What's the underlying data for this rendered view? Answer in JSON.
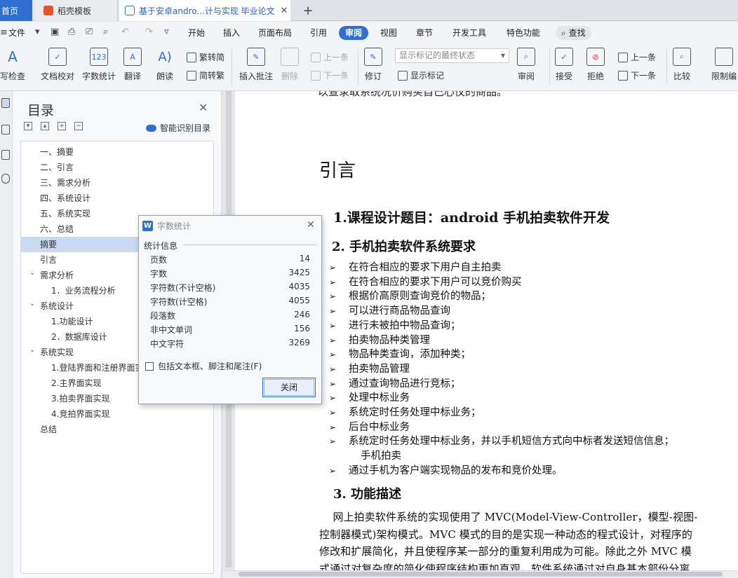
{
  "tabs": {
    "home": "首页",
    "template": "稻壳模板",
    "document": "基于安卓andro...计与实现 毕业论文",
    "add": "+"
  },
  "menu": {
    "file": "文件",
    "items": [
      "开始",
      "插入",
      "页面布局",
      "引用",
      "审阅",
      "视图",
      "章节",
      "开发工具",
      "特色功能"
    ],
    "active": "审阅",
    "search": "查找"
  },
  "ribbon": {
    "spell": "写检查",
    "proof": "文档校对",
    "wordcount": "字数统计",
    "translate": "翻译",
    "read": "朗读",
    "trad": "繁转简",
    "simp": "简转繁",
    "insert_comment": "插入批注",
    "delete": "删除",
    "prev": "上一条",
    "next": "下一条",
    "revise": "修订",
    "markup_state": "显示标记的最终状态",
    "show_markup": "显示标记",
    "review": "审阅",
    "accept": "接受",
    "reject": "拒绝",
    "prev2": "上一条",
    "next2": "下一条",
    "compare": "比较",
    "restrict": "限制编"
  },
  "toc": {
    "title": "目录",
    "smart": "智能识别目录",
    "items": [
      {
        "text": "一、摘要",
        "indent": 1
      },
      {
        "text": "二、引言",
        "indent": 1
      },
      {
        "text": "三、需求分析",
        "indent": 1
      },
      {
        "text": "四、系统设计",
        "indent": 1
      },
      {
        "text": "五、系统实现",
        "indent": 1
      },
      {
        "text": "六、总结",
        "indent": 1
      },
      {
        "text": "摘要",
        "indent": 1,
        "selected": true
      },
      {
        "text": "引言",
        "indent": 1
      },
      {
        "text": "需求分析",
        "indent": 1,
        "expand": true
      },
      {
        "text": "1．业务流程分析",
        "indent": 2
      },
      {
        "text": "系统设计",
        "indent": 1,
        "expand": true
      },
      {
        "text": "1.功能设计",
        "indent": 2
      },
      {
        "text": "2．数据库设计",
        "indent": 2
      },
      {
        "text": "系统实现",
        "indent": 1,
        "expand": true
      },
      {
        "text": "1.登陆界面和注册界面实",
        "indent": 2
      },
      {
        "text": "2.主界面实现",
        "indent": 2
      },
      {
        "text": "3.拍卖界面实现",
        "indent": 2
      },
      {
        "text": "4.竞拍界面实现",
        "indent": 2
      },
      {
        "text": "总结",
        "indent": 1
      }
    ]
  },
  "dialog": {
    "title": "字数统计",
    "section": "统计信息",
    "stats": [
      {
        "label": "页数",
        "value": "14"
      },
      {
        "label": "字数",
        "value": "3425"
      },
      {
        "label": "字符数(不计空格)",
        "value": "4035"
      },
      {
        "label": "字符数(计空格)",
        "value": "4055"
      },
      {
        "label": "段落数",
        "value": "246"
      },
      {
        "label": "非中文单词",
        "value": "156"
      },
      {
        "label": "中文字符",
        "value": "3269"
      }
    ],
    "checkbox": "包括文本框、脚注和尾注(F)",
    "close": "关闭"
  },
  "document": {
    "cut_line": "以查录取系统况价购买自己心仪的商品。",
    "heading": "引言",
    "h_topic": "1.课程设计题目：android 手机拍卖软件开发",
    "h_req": "2.  手机拍卖软件系统要求",
    "bullets": [
      "在符合相应的要求下用户自主拍卖",
      "在符合相应的要求下用户可以竞价购买",
      "根据价高原则查询竞价的物品；",
      "可以进行商品物品查询",
      "进行未被拍中物品查询；",
      "拍卖物品种类管理",
      "物品种类查询，添加种类；",
      "拍卖物品管理",
      "通过查询物品进行竞标；",
      "处理中标业务",
      "系统定时任务处理中标业务；",
      "后台中标业务",
      "系统定时任务处理中标业务，并以手机短信方式向中标者发送短信信息；",
      "通过手机为客户端实现物品的发布和竞价处理。"
    ],
    "bullet_cont": "手机拍卖",
    "h_func": "3. 功能描述",
    "para": [
      "    网上拍卖软件系统的实现使用了 MVC(Model-View-Controller，模型-视图-",
      "控制器模式)架构模式。MVC 模式的目的是实现一种动态的程式设计，对程序的",
      "修改和扩展简化，并且使程序某一部分的重复利用成为可能。除此之外 MVC 模",
      "式通过对复杂度的简化使程序结构更加直观。软件系统通过对自身基本部份分离"
    ]
  }
}
